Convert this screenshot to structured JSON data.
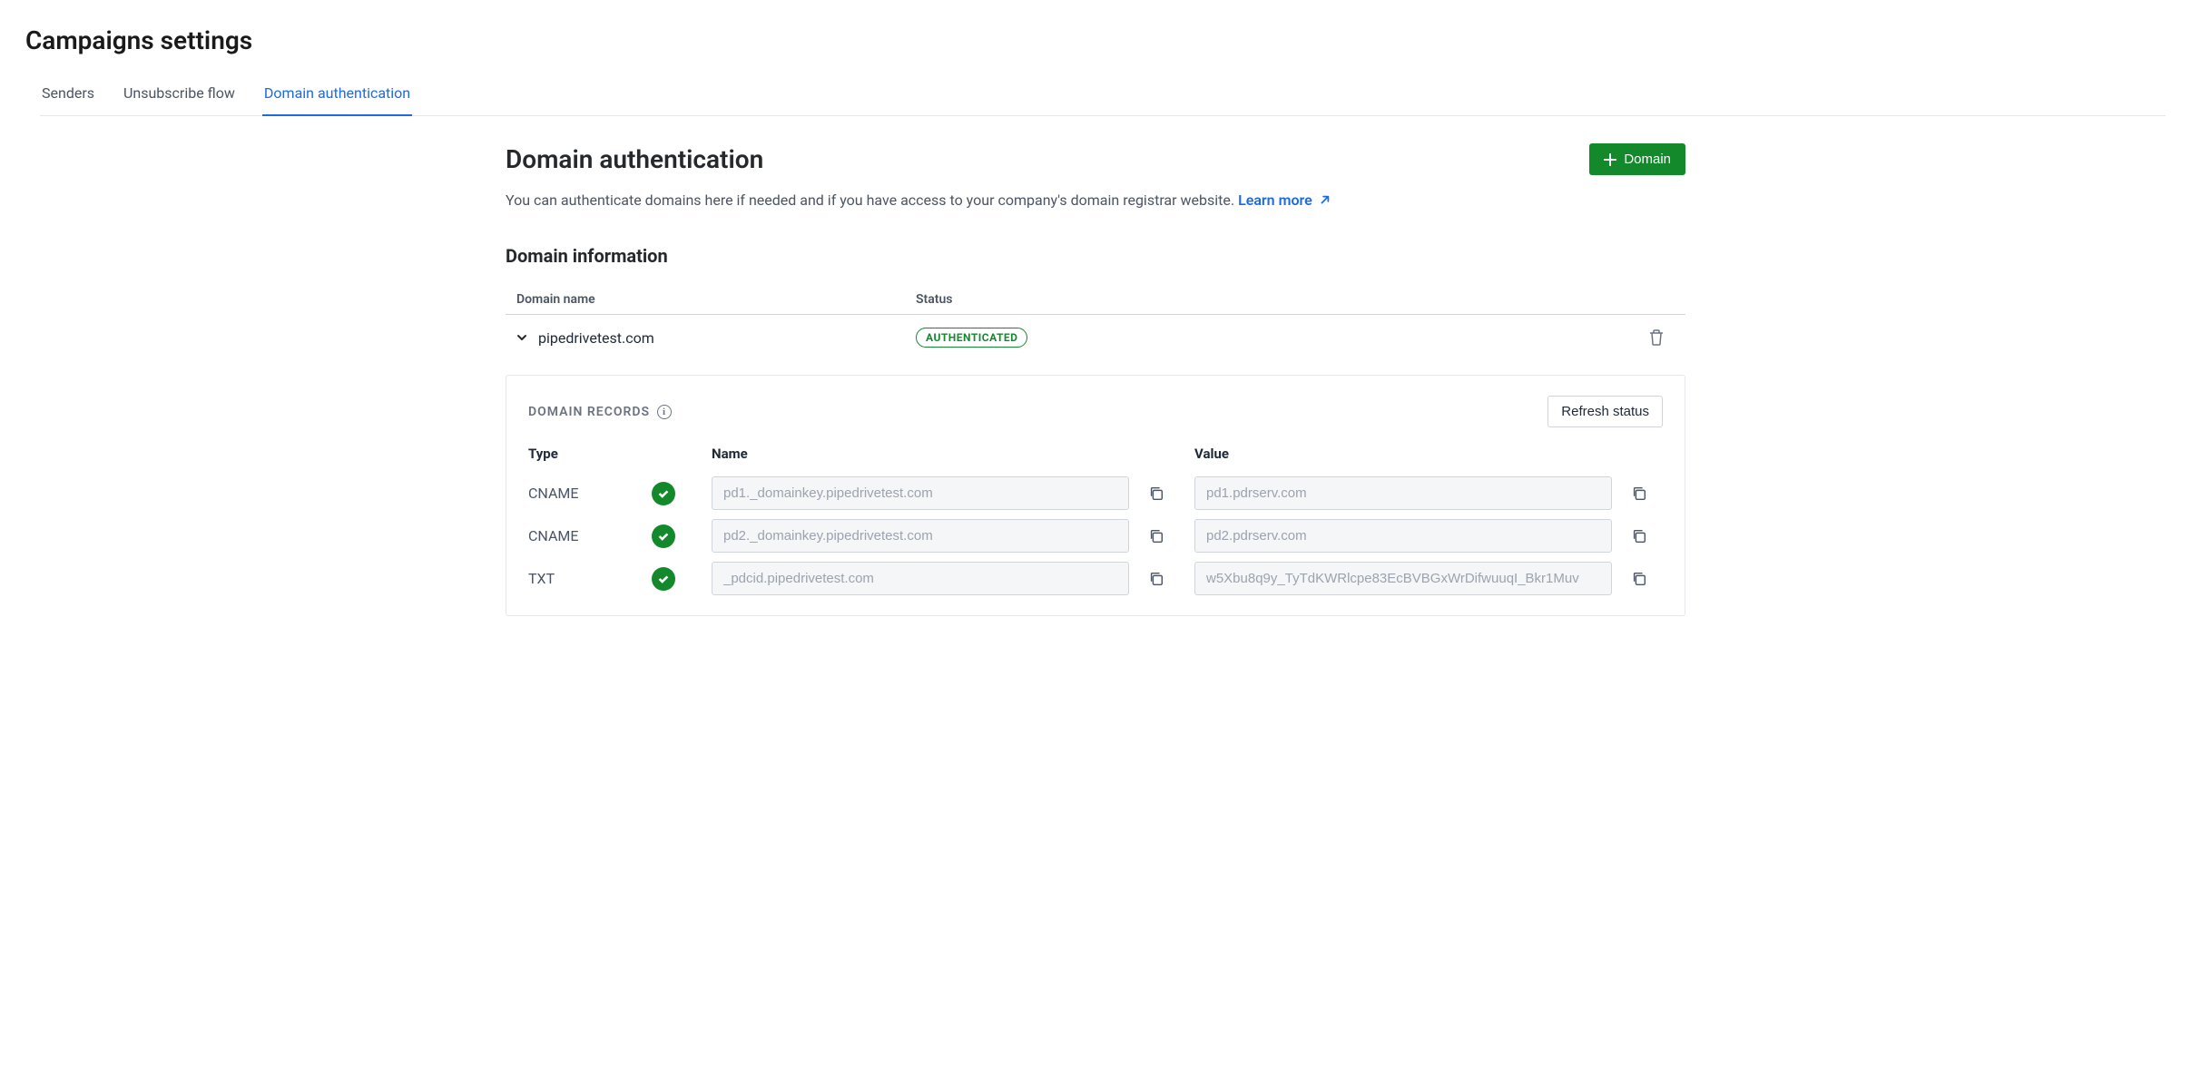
{
  "page": {
    "title": "Campaigns settings"
  },
  "tabs": {
    "senders": "Senders",
    "unsubscribe": "Unsubscribe flow",
    "domain_auth": "Domain authentication"
  },
  "section": {
    "title": "Domain authentication",
    "add_button": "Domain",
    "description": "You can authenticate domains here if needed and if you have access to your company's domain registrar website.",
    "learn_more": "Learn more"
  },
  "domain_info": {
    "title": "Domain information",
    "col_name": "Domain name",
    "col_status": "Status",
    "domain_name": "pipedrivetest.com",
    "status_badge": "AUTHENTICATED"
  },
  "records": {
    "title": "DOMAIN RECORDS",
    "refresh_button": "Refresh status",
    "col_type": "Type",
    "col_name": "Name",
    "col_value": "Value",
    "rows": [
      {
        "type": "CNAME",
        "name": "pd1._domainkey.pipedrivetest.com",
        "value": "pd1.pdrserv.com"
      },
      {
        "type": "CNAME",
        "name": "pd2._domainkey.pipedrivetest.com",
        "value": "pd2.pdrserv.com"
      },
      {
        "type": "TXT",
        "name": "_pdcid.pipedrivetest.com",
        "value": "w5Xbu8q9y_TyTdKWRlcpe83EcBVBGxWrDifwuuqI_Bkr1Muv"
      }
    ]
  }
}
